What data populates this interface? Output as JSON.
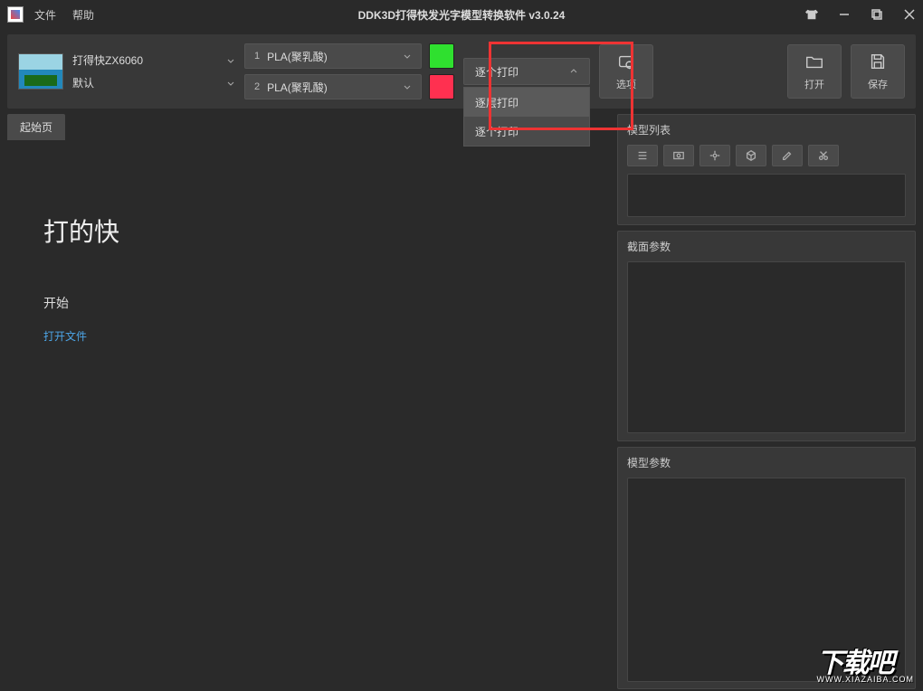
{
  "titlebar": {
    "menu_file": "文件",
    "menu_help": "帮助",
    "title": "DDK3D打得快发光字模型转换软件 v3.0.24"
  },
  "toolbar": {
    "printer": {
      "model": "打得快ZX6060",
      "preset": "默认"
    },
    "materials": [
      {
        "index": "1",
        "name": "PLA(聚乳酸)",
        "color": "#2fe02f"
      },
      {
        "index": "2",
        "name": "PLA(聚乳酸)",
        "color": "#ff3050"
      }
    ],
    "print_mode": {
      "selected": "逐个打印",
      "options": [
        "逐层打印",
        "逐个打印"
      ]
    },
    "buttons": {
      "options": "选项",
      "open": "打开",
      "save": "保存"
    }
  },
  "tabs": {
    "start": "起始页"
  },
  "start_page": {
    "heading": "打的快",
    "start_label": "开始",
    "open_file": "打开文件"
  },
  "right": {
    "model_list": "模型列表",
    "section_params": "截面参数",
    "model_params": "模型参数"
  },
  "watermark": {
    "main": "下载吧",
    "sub": "WWW.XIAZAIBA.COM"
  }
}
